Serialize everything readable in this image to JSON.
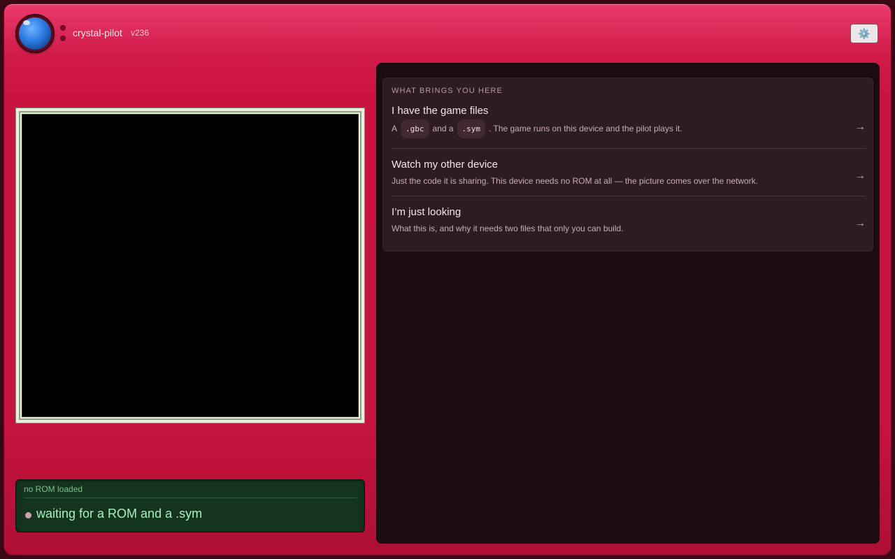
{
  "app": {
    "name": "crystal-pilot",
    "version": "v236"
  },
  "header": {
    "settings_icon": "⚙️"
  },
  "status": {
    "rom_state": "no ROM loaded",
    "message": "waiting for a ROM and a .sym"
  },
  "onboarding": {
    "heading": "WHAT BRINGS YOU HERE",
    "arrow": "→",
    "options": [
      {
        "title": "I have the game files",
        "desc_prefix": "A",
        "code1": ".gbc",
        "desc_mid": "and a",
        "code2": ".sym",
        "desc_suffix": ". The game runs on this device and the pilot plays it."
      },
      {
        "title": "Watch my other device",
        "desc": "Just the code it is sharing. This device needs no ROM at all — the picture comes over the network."
      },
      {
        "title": "I’m just looking",
        "desc": "What this is, and why it needs two files that only you can build."
      }
    ]
  }
}
